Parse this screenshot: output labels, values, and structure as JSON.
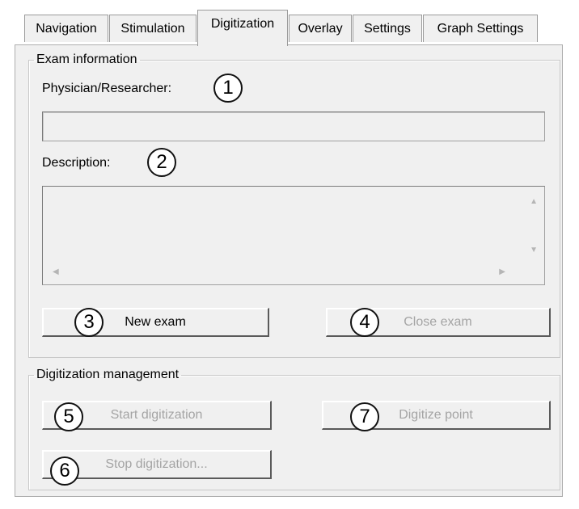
{
  "tabs": [
    {
      "label": "Navigation",
      "active": false
    },
    {
      "label": "Stimulation",
      "active": false
    },
    {
      "label": "Digitization",
      "active": true
    },
    {
      "label": "Overlay",
      "active": false
    },
    {
      "label": "Settings",
      "active": false
    },
    {
      "label": "Graph Settings",
      "active": false
    }
  ],
  "exam_information": {
    "title": "Exam information",
    "physician_label": "Physician/Researcher:",
    "physician_value": "",
    "description_label": "Description:",
    "description_value": "",
    "new_exam_label": "New exam",
    "close_exam_label": "Close exam"
  },
  "digitization_management": {
    "title": "Digitization management",
    "start_label": "Start digitization",
    "digitize_point_label": "Digitize point",
    "stop_label": "Stop digitization..."
  },
  "callouts": [
    "1",
    "2",
    "3",
    "4",
    "5",
    "6",
    "7"
  ],
  "scroll_icons": {
    "up": "▲",
    "down": "▼",
    "left": "◀",
    "right": "▶"
  },
  "colors": {
    "panel_background": "#f0f0f0",
    "disabled_text": "#a4a4a4"
  }
}
